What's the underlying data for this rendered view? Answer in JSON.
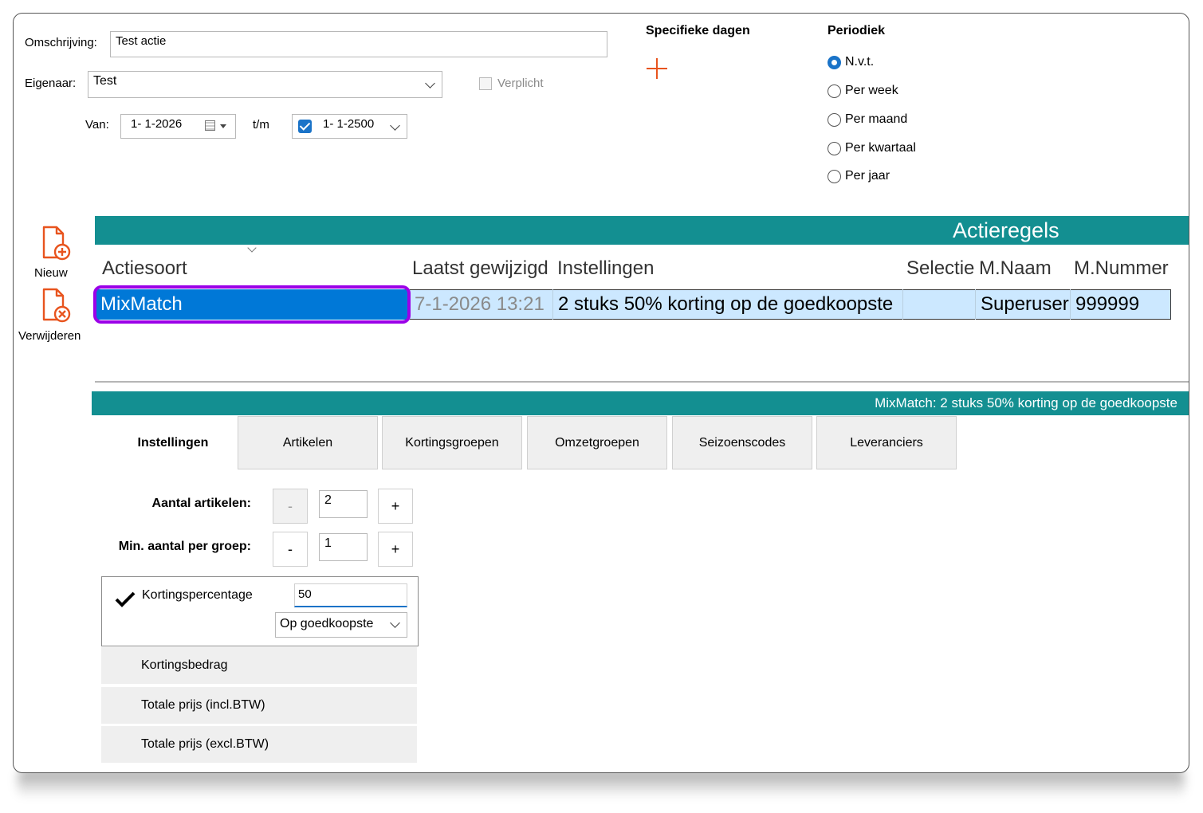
{
  "form": {
    "omschrijving_label": "Omschrijving:",
    "omschrijving_value": "Test actie",
    "eigenaar_label": "Eigenaar:",
    "eigenaar_value": "Test",
    "verplicht_label": "Verplicht",
    "van_label": "Van:",
    "van_value": "1- 1-2026",
    "tm_label": "t/m",
    "tm_value": "1- 1-2500"
  },
  "specifieke_dagen": {
    "title": "Specifieke dagen"
  },
  "periodiek": {
    "title": "Periodiek",
    "options": [
      "N.v.t.",
      "Per week",
      "Per maand",
      "Per kwartaal",
      "Per jaar"
    ],
    "selected": "N.v.t."
  },
  "sidebar": {
    "nieuw_label": "Nieuw",
    "verwijderen_label": "Verwijderen"
  },
  "grid": {
    "title": "Actieregels",
    "columns": [
      "Actiesoort",
      "Laatst gewijzigd",
      "Instellingen",
      "Selectie",
      "M.Naam",
      "M.Nummer"
    ],
    "rows": [
      {
        "actiesoort": "MixMatch",
        "laatst_gewijzigd": "7-1-2026 13:21",
        "instellingen": "2 stuks 50% korting op de goedkoopste",
        "selectie": "",
        "m_naam": "Superuser",
        "m_nummer": "999999"
      }
    ]
  },
  "detail": {
    "summary": "MixMatch: 2 stuks 50% korting op de goedkoopste",
    "tabs": [
      "Instellingen",
      "Artikelen",
      "Kortingsgroepen",
      "Omzetgroepen",
      "Seizoenscodes",
      "Leveranciers"
    ],
    "active_tab": "Instellingen",
    "aantal_artikelen_label": "Aantal artikelen:",
    "aantal_artikelen_value": "2",
    "min_aantal_label": "Min. aantal per groep:",
    "min_aantal_value": "1",
    "minus": "-",
    "plus": "+",
    "korting_options": [
      {
        "label": "Kortingspercentage",
        "selected": true,
        "value": "50",
        "mode": "Op goedkoopste"
      },
      {
        "label": "Kortingsbedrag",
        "selected": false
      },
      {
        "label": "Totale prijs (incl.BTW)",
        "selected": false
      },
      {
        "label": "Totale prijs (excl.BTW)",
        "selected": false
      }
    ]
  },
  "colors": {
    "teal": "#138f91",
    "selection_blue": "#0078d7",
    "highlight_purple": "#9b00e8",
    "accent_orange": "#e8541e",
    "row_light_blue": "#cce8ff"
  }
}
